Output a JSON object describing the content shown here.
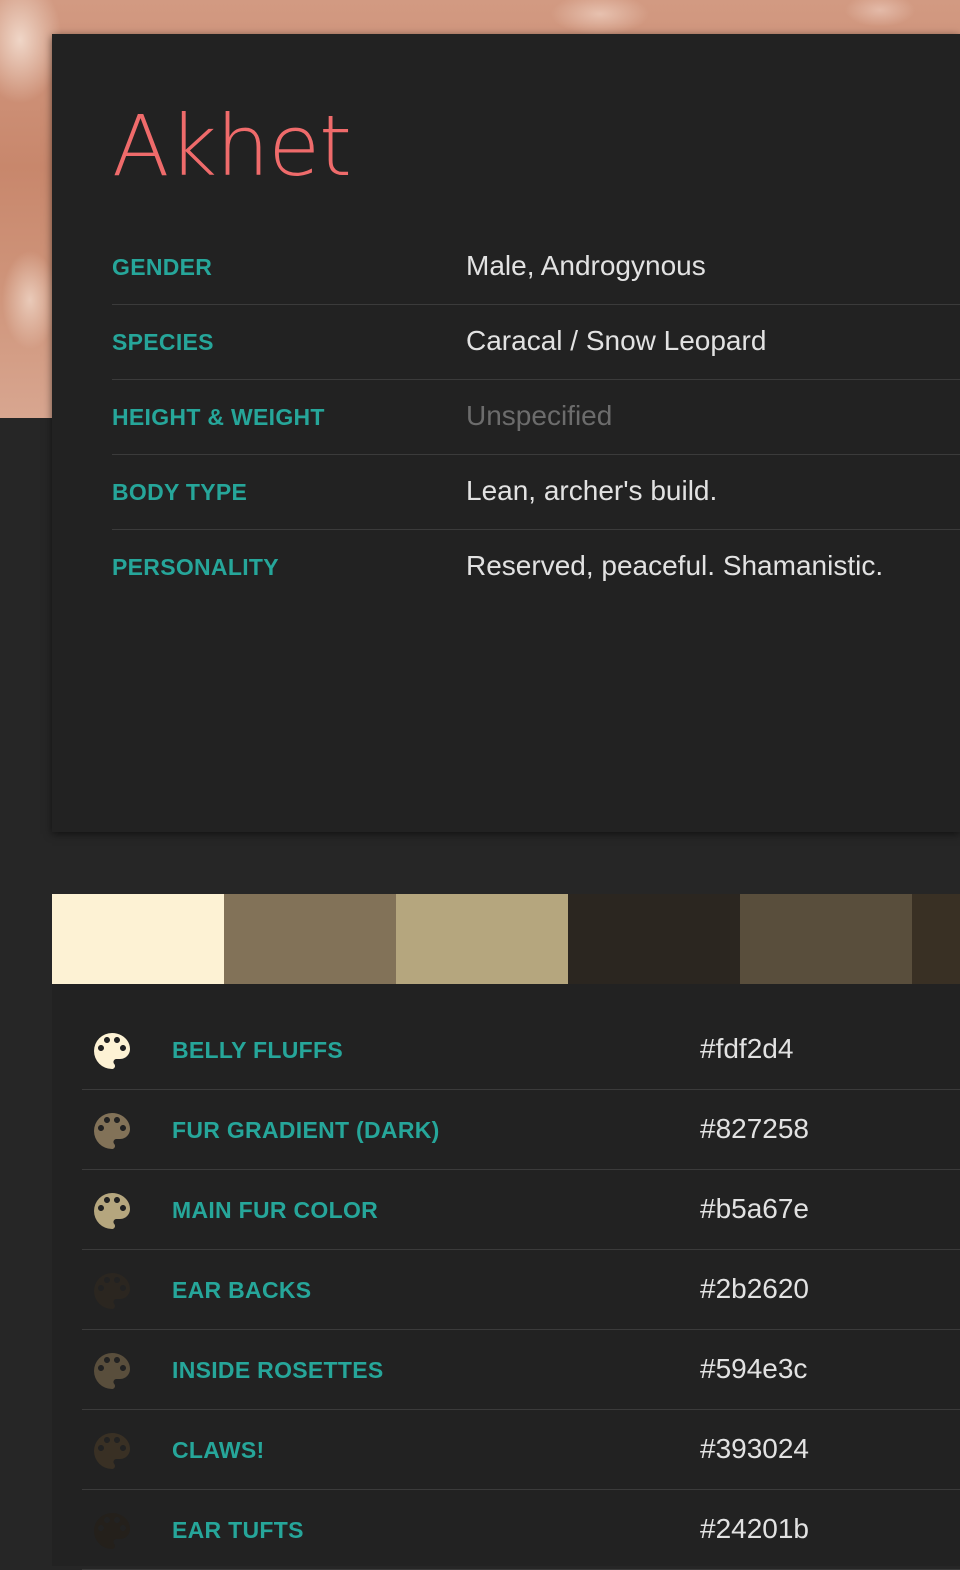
{
  "character": {
    "name": "Akhet",
    "attributes": [
      {
        "label": "GENDER",
        "value": "Male, Androgynous",
        "muted": false
      },
      {
        "label": "SPECIES",
        "value": "Caracal / Snow Leopard",
        "muted": false
      },
      {
        "label": "HEIGHT & WEIGHT",
        "value": "Unspecified",
        "muted": true
      },
      {
        "label": "BODY TYPE",
        "value": "Lean, archer's build.",
        "muted": false
      },
      {
        "label": "PERSONALITY",
        "value": "Reserved, peaceful. Shamanistic.",
        "muted": false
      }
    ]
  },
  "colors": {
    "accent": "#26a69a",
    "name_color": "#ef6b6b",
    "swatches": [
      "#fdf2d4",
      "#827258",
      "#b5a67e",
      "#2b2620",
      "#594e3c",
      "#393024"
    ],
    "items": [
      {
        "label": "BELLY FLUFFS",
        "hex": "#fdf2d4",
        "icon": "palette-icon"
      },
      {
        "label": "FUR GRADIENT (DARK)",
        "hex": "#827258",
        "icon": "palette-icon"
      },
      {
        "label": "MAIN FUR COLOR",
        "hex": "#b5a67e",
        "icon": "palette-icon"
      },
      {
        "label": "EAR BACKS",
        "hex": "#2b2620",
        "icon": "palette-icon"
      },
      {
        "label": "INSIDE ROSETTES",
        "hex": "#594e3c",
        "icon": "palette-icon"
      },
      {
        "label": "CLAWS!",
        "hex": "#393024",
        "icon": "palette-icon"
      },
      {
        "label": "EAR TUFTS",
        "hex": "#24201b",
        "icon": "palette-icon"
      }
    ]
  }
}
